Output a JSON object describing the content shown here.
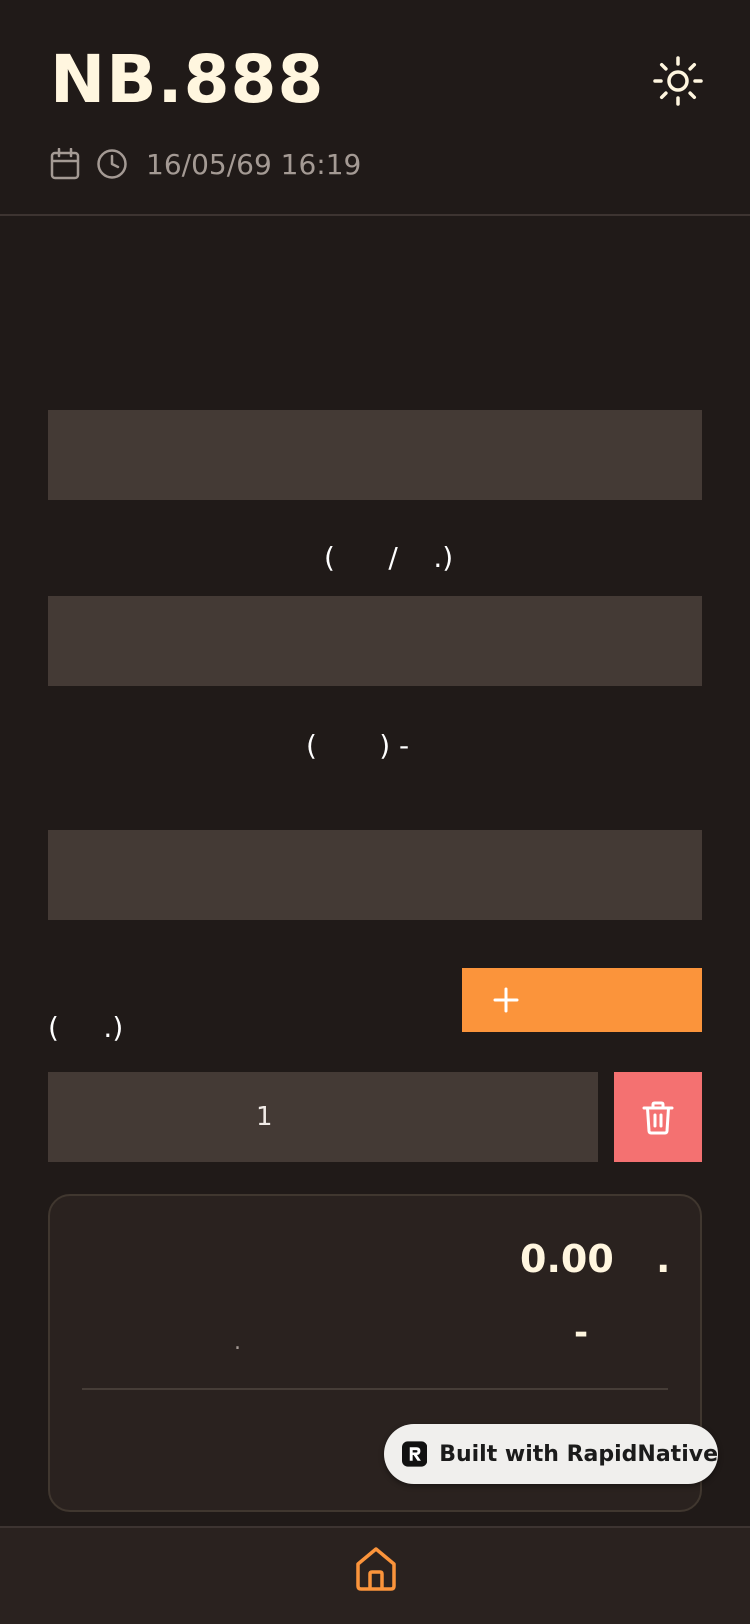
{
  "header": {
    "title": "NB.888",
    "datetime": "16/05/69 16:19",
    "icons": {
      "theme": "sun-icon",
      "date": "calendar-icon",
      "time": "clock-icon"
    }
  },
  "form": {
    "label_1": "(      /    .)",
    "label_2": "(       ) -",
    "label_3": "(     .)",
    "field_1_value": "",
    "field_2_value": "",
    "field_3_value": "",
    "quantity": "1",
    "add_label": "+"
  },
  "summary": {
    "total": "0.00",
    "total_unit": ".",
    "discount_label": ".",
    "discount_value": "-"
  },
  "badge": {
    "text": "Built with RapidNative"
  },
  "nav": {
    "home": "home-icon"
  },
  "colors": {
    "background": "#201a18",
    "field": "#443a35",
    "accent": "#fb943b",
    "danger": "#f47171",
    "title": "#fff6df"
  }
}
